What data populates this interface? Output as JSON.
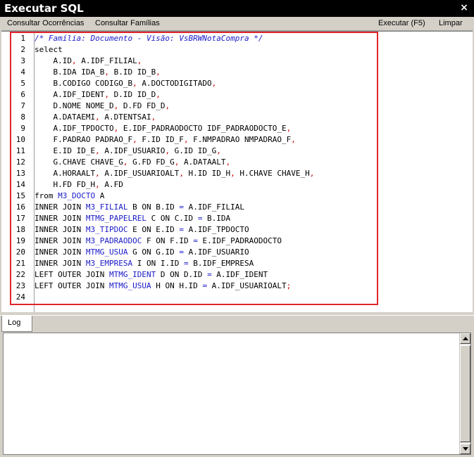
{
  "window": {
    "title": "Executar SQL",
    "close_label": "×"
  },
  "toolbar": {
    "consultar_ocorrencias": "Consultar Ocorrências",
    "consultar_familias": "Consultar Famílias",
    "executar": "Executar (F5)",
    "limpar": "Limpar"
  },
  "editor": {
    "lines": [
      "/* Família: Documento - Visão: VsBRWNotaCompra */",
      "select",
      "    A.ID, A.IDF_FILIAL,",
      "    B.IDA IDA_B, B.ID ID_B,",
      "    B.CODIGO CODIGO_B, A.DOCTODIGITADO,",
      "    A.IDF_IDENT, D.ID ID_D,",
      "    D.NOME NOME_D, D.FD FD_D,",
      "    A.DATAEMI, A.DTENTSAI,",
      "    A.IDF_TPDOCTO, E.IDF_PADRAODOCTO IDF_PADRAODOCTO_E,",
      "    F.PADRAO PADRAO_F, F.ID ID_F, F.NMPADRAO NMPADRAO_F,",
      "    E.ID ID_E, A.IDF_USUARIO, G.ID ID_G,",
      "    G.CHAVE CHAVE_G, G.FD FD_G, A.DATAALT,",
      "    A.HORAALT, A.IDF_USUARIOALT, H.ID ID_H, H.CHAVE CHAVE_H,",
      "    H.FD FD_H, A.FD",
      "from M3_DOCTO A",
      "INNER JOIN M3_FILIAL B ON B.ID = A.IDF_FILIAL",
      "INNER JOIN MTMG_PAPELREL C ON C.ID = B.IDA",
      "INNER JOIN M3_TIPDOC E ON E.ID = A.IDF_TPDOCTO",
      "INNER JOIN M3_PADRAODOC F ON F.ID = E.IDF_PADRAODOCTO",
      "INNER JOIN MTMG_USUA G ON G.ID = A.IDF_USUARIO",
      "INNER JOIN M3_EMPRESA I ON I.ID = B.IDF_EMPRESA",
      "LEFT OUTER JOIN MTMG_IDENT D ON D.ID = A.IDF_IDENT",
      "LEFT OUTER JOIN MTMG_USUA H ON H.ID = A.IDF_USUARIOALT;",
      ""
    ],
    "line_numbers": [
      "1",
      "2",
      "3",
      "4",
      "5",
      "6",
      "7",
      "8",
      "9",
      "10",
      "11",
      "12",
      "13",
      "14",
      "15",
      "16",
      "17",
      "18",
      "19",
      "20",
      "21",
      "22",
      "23",
      "24"
    ]
  },
  "log": {
    "tab_label": "Log",
    "content": ""
  },
  "icons": {
    "close": "close-icon",
    "scroll_up": "arrow-up-icon",
    "scroll_down": "arrow-down-icon"
  },
  "colors": {
    "highlight_frame": "#e0242b",
    "keyword_blue": "#1a1ac8",
    "separator_red": "#c80000"
  }
}
